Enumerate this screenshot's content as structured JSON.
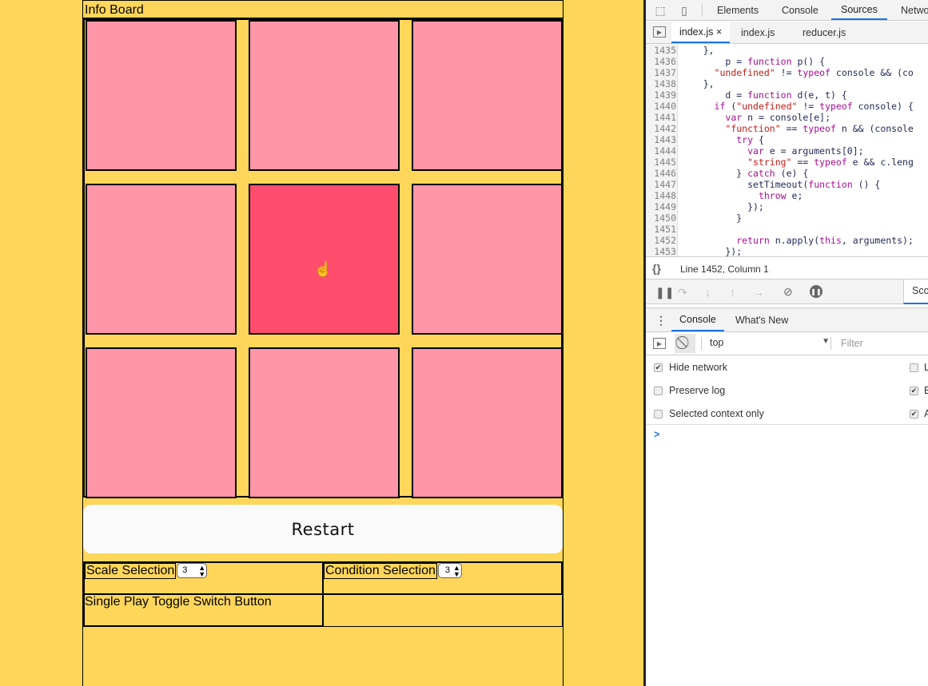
{
  "app": {
    "title": "Info Board",
    "restart_label": "Restart",
    "board": {
      "size": 3,
      "active_cell": 4,
      "cell_color": "#ff96a8",
      "active_color": "#ff4d6d"
    },
    "scale_label": "Scale Selection",
    "scale_value": "3",
    "condition_label": "Condition Selection",
    "condition_value": "3",
    "single_play_label": "Single Play Toggle Switch Button"
  },
  "devtools": {
    "tabs": [
      "Elements",
      "Console",
      "Sources",
      "Netwo"
    ],
    "active_tab": "Sources",
    "files": [
      "index.js",
      "index.js",
      "reducer.js"
    ],
    "close_glyph": "×",
    "code": [
      {
        "n": "1435",
        "t": "    },"
      },
      {
        "n": "1436",
        "t": "        p = function p() {"
      },
      {
        "n": "1437",
        "t": "      \"undefined\" != typeof console && (co"
      },
      {
        "n": "1438",
        "t": "    },"
      },
      {
        "n": "1439",
        "t": "        d = function d(e, t) {"
      },
      {
        "n": "1440",
        "t": "      if (\"undefined\" != typeof console) {"
      },
      {
        "n": "1441",
        "t": "        var n = console[e];"
      },
      {
        "n": "1442",
        "t": "        \"function\" == typeof n && (console"
      },
      {
        "n": "1443",
        "t": "          try {"
      },
      {
        "n": "1444",
        "t": "            var e = arguments[0];"
      },
      {
        "n": "1445",
        "t": "            \"string\" == typeof e && c.leng"
      },
      {
        "n": "1446",
        "t": "          } catch (e) {"
      },
      {
        "n": "1447",
        "t": "            setTimeout(function () {"
      },
      {
        "n": "1448",
        "t": "              throw e;"
      },
      {
        "n": "1449",
        "t": "            });"
      },
      {
        "n": "1450",
        "t": "          }"
      },
      {
        "n": "1451",
        "t": ""
      },
      {
        "n": "1452",
        "t": "          return n.apply(this, arguments);"
      },
      {
        "n": "1453",
        "t": "        });"
      }
    ],
    "status": "Line 1452, Column 1",
    "braces": "{}",
    "scope_tab": "Sco",
    "drawer_tabs": [
      "Console",
      "What's New"
    ],
    "context": "top",
    "filter_placeholder": "Filter",
    "options": [
      {
        "label": "Hide network",
        "checked": true
      },
      {
        "label": "Preserve log",
        "checked": false
      },
      {
        "label": "Selected context only",
        "checked": false
      }
    ],
    "right_options": [
      {
        "label": "L",
        "checked": false
      },
      {
        "label": "E",
        "checked": true
      },
      {
        "label": "A",
        "checked": true
      }
    ],
    "prompt": ">"
  }
}
